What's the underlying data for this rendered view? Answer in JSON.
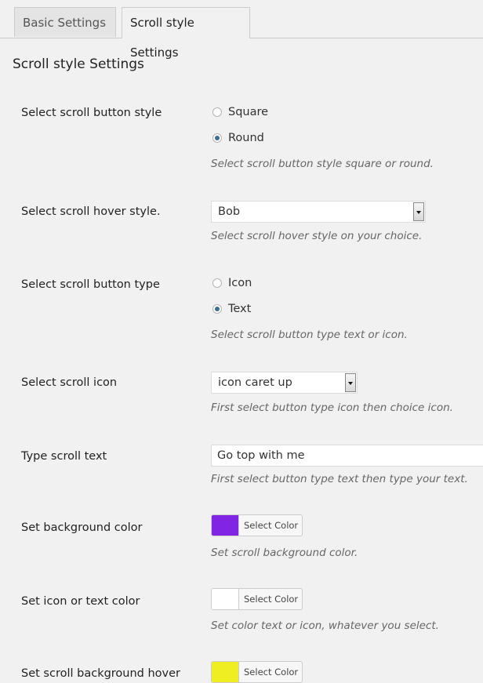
{
  "tabs": [
    {
      "label": "Basic Settings",
      "active": false
    },
    {
      "label": "Scroll style Settings",
      "active": true
    }
  ],
  "section_title": "Scroll style Settings",
  "fields": {
    "button_style": {
      "label": "Select scroll button style",
      "options": [
        "Square",
        "Round"
      ],
      "selected": "Round",
      "description": "Select scroll button style square or round."
    },
    "hover_style": {
      "label": "Select scroll hover style.",
      "value": "Bob",
      "description": "Select scroll hover style on your choice."
    },
    "button_type": {
      "label": "Select scroll button type",
      "options": [
        "Icon",
        "Text"
      ],
      "selected": "Text",
      "description": "Select scroll button type text or icon."
    },
    "scroll_icon": {
      "label": "Select scroll icon",
      "value": "icon caret up",
      "description": "First select button type icon then choice icon."
    },
    "scroll_text": {
      "label": "Type scroll text",
      "value": "Go top with me",
      "description": "First select button type text then type your text."
    },
    "bg_color": {
      "label": "Set background color",
      "button_label": "Select Color",
      "color": "#8224e3",
      "description": "Set scroll background color."
    },
    "icon_color": {
      "label": "Set icon or text color",
      "button_label": "Select Color",
      "color": "#ffffff",
      "description": "Set color text or icon, whatever you select."
    },
    "bg_hover": {
      "label": "Set scroll background hover",
      "button_label": "Select Color",
      "color": "#eeee22"
    }
  }
}
